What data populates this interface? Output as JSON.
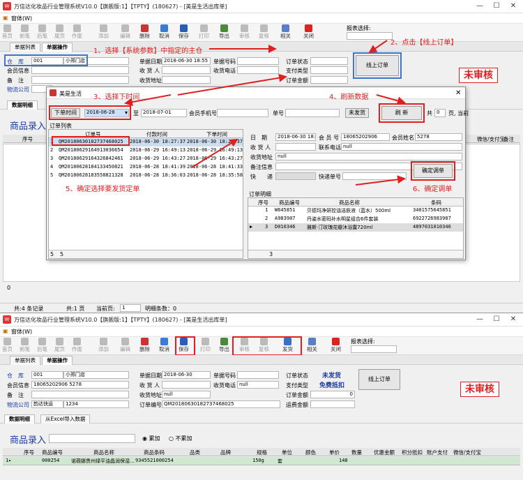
{
  "window": {
    "app_title": "万信达化妆品行业管理系统V10.0【旗舰版:1】【TPTY】(180627) - [美是生活出库单]",
    "menu_label": "窗体(W)"
  },
  "toolbar": {
    "first": "首页",
    "prev": "前笔",
    "next": "后笔",
    "last": "尾页",
    "void": "作废",
    "add": "添加",
    "edit": "编辑",
    "delete": "删除",
    "cancel": "取消",
    "save": "保存",
    "print": "打印",
    "export": "导出",
    "review": "审核",
    "recheck": "复核",
    "ship": "发货",
    "related": "相关",
    "close": "关闭",
    "report_select": "报表选择:"
  },
  "tabs": {
    "list": "单据列表",
    "operation": "单据操作"
  },
  "form_top": {
    "warehouse_label": "仓　库",
    "warehouse_code": "001",
    "warehouse_name": "小郑门店",
    "member_label": "会员信息",
    "remark_label": "备　注",
    "logistics_label": "物流公司",
    "doc_date_label": "单据日期",
    "doc_date": "2018-06-30 18:55",
    "receiver_label": "收 货 人",
    "address_label": "收货地址",
    "doc_no_label": "单据号码",
    "phone_label": "收货电话",
    "order_status_label": "订单状态",
    "pay_type_label": "支付类型",
    "order_amount_label": "订单金额",
    "online_order_button": "线上订单",
    "status_stamp": "未审核"
  },
  "detail_tabs": {
    "detail": "数据明细",
    "import": "从Excel导入数据"
  },
  "product_entry": {
    "label": "商品录入",
    "accumulate": "累加",
    "no_accumulate": "不累加"
  },
  "top_grid": {
    "columns": [
      "序号",
      "商品编号",
      "商品名称",
      "商品条码",
      "品类",
      "品牌",
      "规格",
      "单位",
      "颜色",
      "单价",
      "数量",
      "优惠金额",
      "积分抵扣",
      "账户支付",
      "微信/支付宝",
      "备注"
    ]
  },
  "top_status": {
    "total": "共:4 条记录",
    "pages": "共:1 页",
    "current_page_label": "当前页:",
    "current_page": "1",
    "detail_count": "明细条数：0"
  },
  "dialog": {
    "title": "美是生活",
    "order_time_button": "下单时间",
    "date_from": "2018-06-28",
    "to_label": "至",
    "date_to": "2018-07-01",
    "member_phone_label": "会员手机号",
    "order_no_label": "单号",
    "unshipped_button": "未发货",
    "refresh_button": "刷 新",
    "total_label": "共",
    "total_value": "0",
    "page_label": "页, 当前",
    "order_list_label": "订单列表",
    "order_columns": [
      "订单号",
      "付款时间",
      "下单时间"
    ],
    "orders": [
      {
        "idx": "1",
        "order_no": "QM20180630182737468025",
        "paid": "2018-06-30 18:27:37",
        "placed": "2018-06-30 18:27:37"
      },
      {
        "idx": "2",
        "order_no": "QM20180629164913036654",
        "paid": "2018-06-29 16:49:13",
        "placed": "2018-06-29 16:49:13"
      },
      {
        "idx": "3",
        "order_no": "QM20180629164326842461",
        "paid": "2018-06-29 16:43:27",
        "placed": "2018-06-29 16:43:27"
      },
      {
        "idx": "4",
        "order_no": "QM20180628184133450821",
        "paid": "2018-06-28 18:41:39",
        "placed": "2018-06-28 18:41:33"
      },
      {
        "idx": "5",
        "order_no": "QM20180628183558821328",
        "paid": "2018-06-28 18:36:03",
        "placed": "2018-06-28 18:35:58"
      }
    ],
    "footer_left": "5",
    "footer_right": "5",
    "detail": {
      "date_label": "日　期",
      "date": "2018-06-30 18:27",
      "member_no_label": "会 员 号",
      "member_no": "18065202906",
      "member_name_label": "会员姓名",
      "member_name": "5278",
      "receiver_label": "收 货 人",
      "contact_label": "联系电话",
      "contact": "null",
      "address_label": "收货地址",
      "address": "null",
      "remark_label": "备注信息",
      "express_label": "快　　递",
      "express_no_label": "快递单号",
      "confirm_button": "确定调单"
    },
    "item_detail_label": "订单明细",
    "item_columns": [
      "序号",
      "商品编号",
      "商品名称",
      "条码"
    ],
    "items": [
      {
        "idx": "1",
        "code": "W645851",
        "name": "贝德玛净妍控油洁肤液（蓝水）500ml",
        "barcode": "3401575645851"
      },
      {
        "idx": "2",
        "code": "A983907",
        "name": "丹姿水密码补水明星组合6件套装",
        "barcode": "6922726983907"
      },
      {
        "idx": "3",
        "code": "D010346",
        "name": "雅斯·汀玫瑰花瓣沐浴露720ml",
        "barcode": "4897031010346"
      }
    ],
    "items_footer": "3"
  },
  "annotations": {
    "step1": "1、选择【系统参数】中指定的主仓",
    "step2": "2、点击【线上订单】",
    "step3": "3、选择下时间",
    "step4": "4、刷新数据",
    "step5": "5、确定选择要发货定单",
    "step6": "6、确定调单"
  },
  "bottom_form": {
    "warehouse_code": "001",
    "warehouse_name": "小郑门店",
    "member_value": "18065202906 5278",
    "logistics_value": "韵达快运",
    "logistics_no": "1234",
    "doc_date": "2018-06-30",
    "address": "null",
    "phone": "null",
    "order_no_label": "订单编号",
    "order_no": "QM20180630182737468025",
    "order_status": "未发货",
    "pay_type": "免费抵扣",
    "order_amount": "0",
    "freight_label": "运费金额"
  },
  "bottom_grid": {
    "columns": [
      "商品编号",
      "商品名称",
      "商品条码",
      "品类",
      "品牌",
      "规格",
      "单位",
      "颜色",
      "单价",
      "数量",
      "优惠金额",
      "积分抵扣",
      "账户支付",
      "微信/支付宝"
    ],
    "row": {
      "idx": "1",
      "code": "000254",
      "name": "诺薇娜贵州绿平油晶润保湿...",
      "barcode": "9345521000254",
      "spec": "150g",
      "unit": "套",
      "price": "148"
    }
  }
}
